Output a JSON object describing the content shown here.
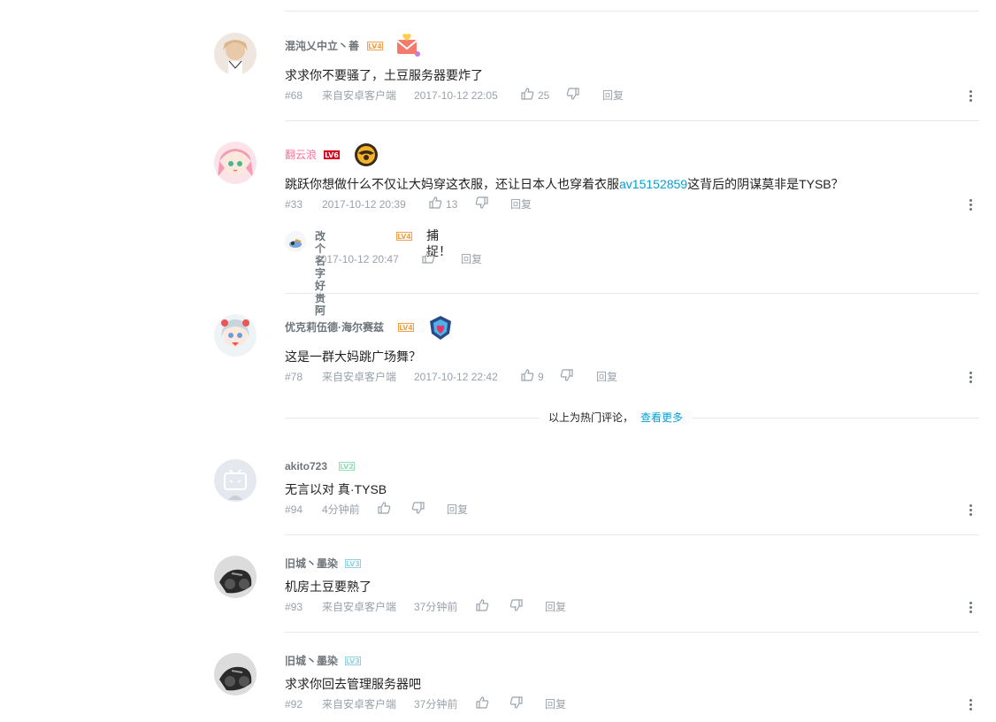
{
  "hot_separator": {
    "text": "以上为热门评论，",
    "more_link": "查看更多"
  },
  "labels": {
    "reply": "回复"
  },
  "comments": [
    {
      "user": "混沌乂中立丶善",
      "level": "LV4",
      "text": "求求你不要骚了，土豆服务器要炸了",
      "floor": "#68",
      "source": "来自安卓客户端",
      "time": "2017-10-12 22:05",
      "likes": "25"
    },
    {
      "user": "翻云浪",
      "level": "LV6",
      "text_before": "跳跃你想做什么不仅让大妈穿这衣服，还让日本人也穿着衣服",
      "text_link": "av15152859",
      "text_after": "这背后的阴谋莫非是TYSB？",
      "floor": "#33",
      "time": "2017-10-12 20:39",
      "likes": "13",
      "reply": {
        "user": "改个名字好贵阿",
        "level": "LV4",
        "text": "捕捉！",
        "time": "2017-10-12 20:47"
      }
    },
    {
      "user": "优克莉伍德·海尔赛兹",
      "level": "LV4",
      "text": "这是一群大妈跳广场舞？",
      "floor": "#78",
      "source": "来自安卓客户端",
      "time": "2017-10-12 22:42",
      "likes": "9"
    },
    {
      "user": "akito723",
      "level": "LV2",
      "text": "无言以对 真·TYSB",
      "floor": "#94",
      "time": "4分钟前"
    },
    {
      "user": "旧城丶墨染",
      "level": "LV3",
      "text": "机房土豆要熟了",
      "floor": "#93",
      "source": "来自安卓客户端",
      "time": "37分钟前"
    },
    {
      "user": "旧城丶墨染",
      "level": "LV3",
      "text": "求求你回去管理服务器吧",
      "floor": "#92",
      "source": "来自安卓客户端",
      "time": "37分钟前"
    }
  ],
  "colors": {
    "link": "#00a1d6",
    "pink_name": "#fb7299",
    "meta": "#99a2aa",
    "divider": "#e5e9ef"
  },
  "icons": [
    "like-icon",
    "dislike-icon",
    "more-options-icon",
    "fan-badge-icon"
  ]
}
